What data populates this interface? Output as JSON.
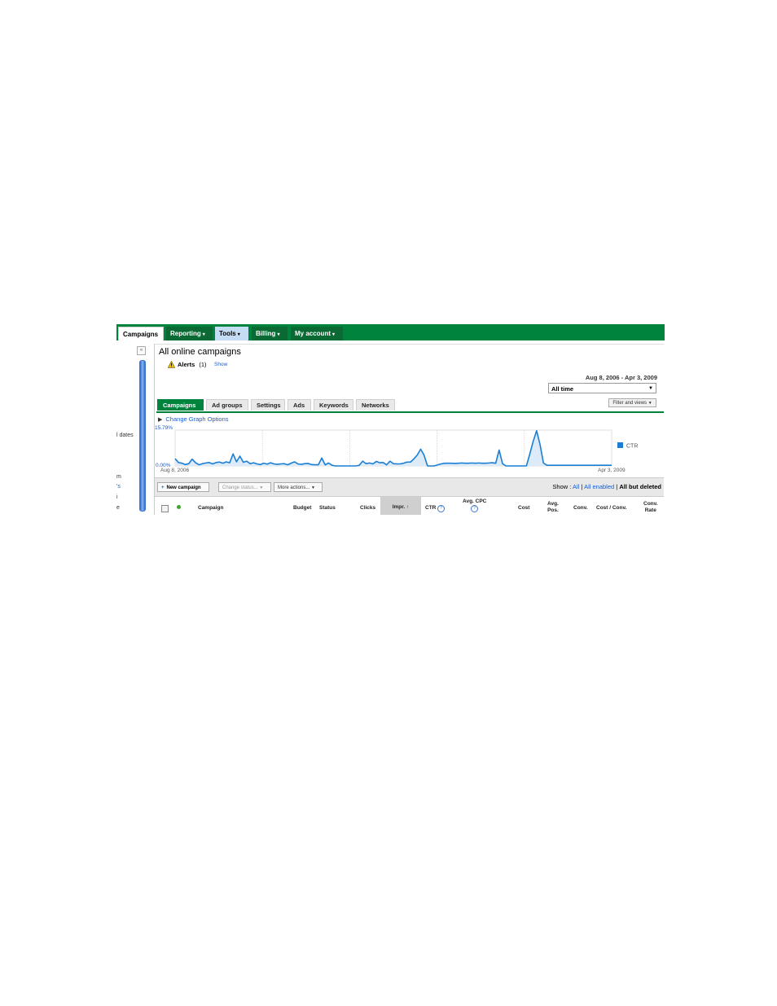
{
  "nav": {
    "tabs": [
      {
        "label": "Campaigns",
        "state": "active"
      },
      {
        "label": "Reporting",
        "caret": "▾"
      },
      {
        "label": "Tools",
        "caret": "▾",
        "state": "highlighted"
      },
      {
        "label": "Billing",
        "caret": "▾"
      },
      {
        "label": "My account",
        "caret": "▾"
      }
    ],
    "color": "#00843d"
  },
  "sidebar": {
    "collapse_label": "«",
    "fragments": [
      {
        "text": "l dates",
        "link": false
      },
      {
        "text": "m",
        "link": false
      },
      {
        "text": "'s",
        "link": true
      },
      {
        "text": "i",
        "link": false
      },
      {
        "text": "e",
        "link": false
      }
    ]
  },
  "header": {
    "title": "All online campaigns",
    "alerts_label": "Alerts",
    "alerts_count": "(1)",
    "alerts_show": "Show",
    "date_range": "Aug 8, 2006 - Apr 3, 2009",
    "date_select": "All time",
    "filter_button": "Filter and views"
  },
  "subtabs": [
    {
      "label": "Campaigns",
      "active": true
    },
    {
      "label": "Ad groups"
    },
    {
      "label": "Settings"
    },
    {
      "label": "Ads"
    },
    {
      "label": "Keywords"
    },
    {
      "label": "Networks"
    }
  ],
  "graph_options": "Change Graph Options",
  "chart_data": {
    "type": "area",
    "series": [
      {
        "name": "CTR",
        "values": [
          3.2,
          1.5,
          1.2,
          0.6,
          1.0,
          3.0,
          1.4,
          0.5,
          1.0,
          1.3,
          1.5,
          0.9,
          1.5,
          1.7,
          1.2,
          1.8,
          1.4,
          5.3,
          1.8,
          4.3,
          1.6,
          2.1,
          1.0,
          1.4,
          0.9,
          0.6,
          1.2,
          0.8,
          1.4,
          0.9,
          0.7,
          0.9,
          1.0,
          0.5,
          1.2,
          1.8,
          0.9,
          0.7,
          1.0,
          1.1,
          0.6,
          0.5,
          0.5,
          3.5,
          0.5,
          1.3,
          0.3,
          0,
          0,
          0,
          0,
          0,
          0,
          0,
          0.3,
          2.1,
          1.0,
          1.3,
          0.9,
          2.0,
          1.4,
          1.5,
          0.5,
          2.1,
          1.0,
          0.9,
          0.9,
          1.2,
          1.7,
          1.7,
          3.1,
          4.8,
          7.4,
          4.7,
          0,
          0,
          0,
          0.5,
          0.9,
          1.2,
          1.2,
          1.2,
          1.1,
          1.2,
          1.3,
          1.2,
          1.2,
          1.3,
          1.2,
          1.3,
          1.2,
          1.2,
          1.3,
          1.4,
          1.2,
          7.0,
          1.0,
          0,
          0,
          0,
          0,
          0,
          0,
          0,
          5.3,
          10.9,
          15.5,
          9.4,
          1.3,
          0.3,
          0.3,
          0.3,
          0.3,
          0.3,
          0.3,
          0.3,
          0.3,
          0.3,
          0.3,
          0.3,
          0.3,
          0.3,
          0.3,
          0.3,
          0.3,
          0.3,
          0.3,
          0.3,
          0.3
        ]
      }
    ],
    "x_start_label": "Aug 8, 2006",
    "x_end_label": "Apr 3, 2009",
    "y_max_label": "15.79%",
    "y_min_label": "0.00%",
    "ylim": [
      0,
      15.79
    ],
    "legend_position": "right",
    "line_color": "#1a7fd4",
    "fill_color": "#dcebf7"
  },
  "toolbar": {
    "new_campaign": "New campaign",
    "new_campaign_icon": "+",
    "change_status": "Change status...",
    "more_actions": "More actions...",
    "show_label": "Show :",
    "show_all": "All",
    "show_enabled": "All enabled",
    "show_but_deleted": "All but deleted"
  },
  "table": {
    "columns": [
      "Campaign",
      "Budget",
      "Status",
      "Clicks",
      "Impr.",
      "CTR",
      "Avg. CPC",
      "Cost",
      "Avg.",
      "Pos.",
      "Conv.",
      "Cost / Conv.",
      "Conv.",
      "Rate"
    ],
    "help_glyph": "?",
    "sort_arrow": "↑"
  }
}
